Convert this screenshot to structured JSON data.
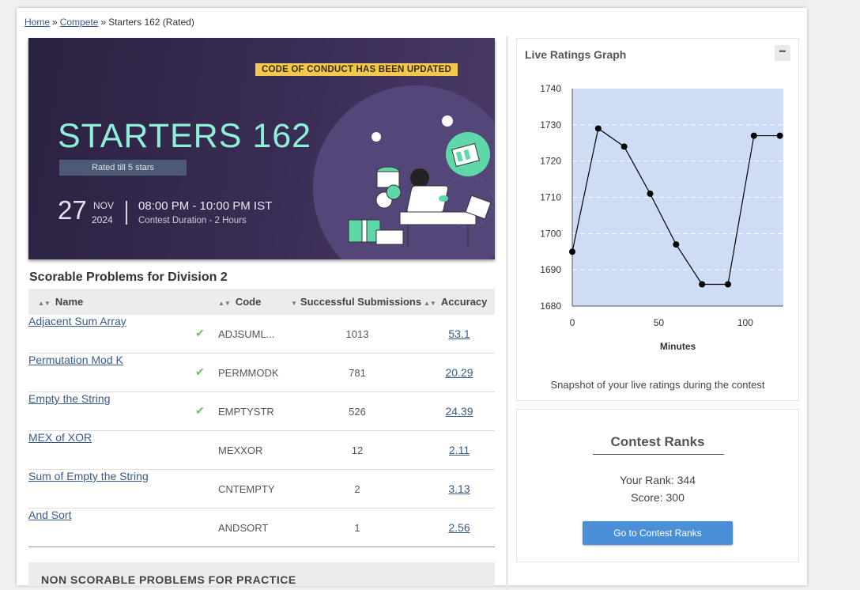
{
  "breadcrumb": {
    "home": "Home",
    "sep1": "»",
    "compete": "Compete",
    "sep2": "»",
    "current": "Starters 162 (Rated)"
  },
  "banner": {
    "notice": "CODE OF CONDUCT HAS BEEN UPDATED",
    "title": "STARTERS 162",
    "rated": "Rated till 5 stars",
    "day": "27",
    "month": "NOV",
    "year": "2024",
    "time": "08:00 PM - 10:00 PM IST",
    "duration": "Contest Duration - 2 Hours"
  },
  "problems": {
    "title": "Scorable Problems for Division 2",
    "columns": [
      "Name",
      "Code",
      "Successful Submissions",
      "Accuracy"
    ],
    "rows": [
      {
        "name": "Adjacent Sum Array",
        "solved": true,
        "code": "ADJSUML...",
        "submissions": "1013",
        "accuracy": "53.1"
      },
      {
        "name": "Permutation Mod K",
        "solved": true,
        "code": "PERMMODK",
        "submissions": "781",
        "accuracy": "20.29"
      },
      {
        "name": "Empty the String",
        "solved": true,
        "code": "EMPTYSTR",
        "submissions": "526",
        "accuracy": "24.39"
      },
      {
        "name": "MEX of XOR",
        "solved": false,
        "code": "MEXXOR",
        "submissions": "12",
        "accuracy": "2.11"
      },
      {
        "name": "Sum of Empty the String",
        "solved": false,
        "code": "CNTEMPTY",
        "submissions": "2",
        "accuracy": "3.13"
      },
      {
        "name": "And Sort",
        "solved": false,
        "code": "ANDSORT",
        "submissions": "1",
        "accuracy": "2.56"
      }
    ],
    "check_icon": "✔",
    "next_section": "NON SCORABLE PROBLEMS FOR PRACTICE"
  },
  "graph": {
    "title": "Live Ratings Graph",
    "toggle": "−",
    "caption": "Snapshot of your live ratings during the contest",
    "chart_data": {
      "type": "line",
      "xlabel": "Minutes",
      "ylabel": "",
      "xlim": [
        0,
        122
      ],
      "ylim": [
        1680,
        1740
      ],
      "xticks": [
        0,
        50,
        100
      ],
      "yticks": [
        1680,
        1690,
        1700,
        1710,
        1720,
        1730,
        1740
      ],
      "grid": true,
      "colors": {
        "plot_bg": "#cfdcf5",
        "line": "#000000",
        "grid": "#ffffff"
      },
      "x": [
        0,
        15,
        30,
        45,
        60,
        75,
        90,
        105,
        120
      ],
      "y": [
        1695,
        1729,
        1724,
        1711,
        1697,
        1686,
        1686,
        1727,
        1727
      ]
    }
  },
  "ranks": {
    "title": "Contest Ranks",
    "rank_text": "Your Rank: 344",
    "score_text": "Score: 300",
    "button": "Go to Contest Ranks"
  }
}
